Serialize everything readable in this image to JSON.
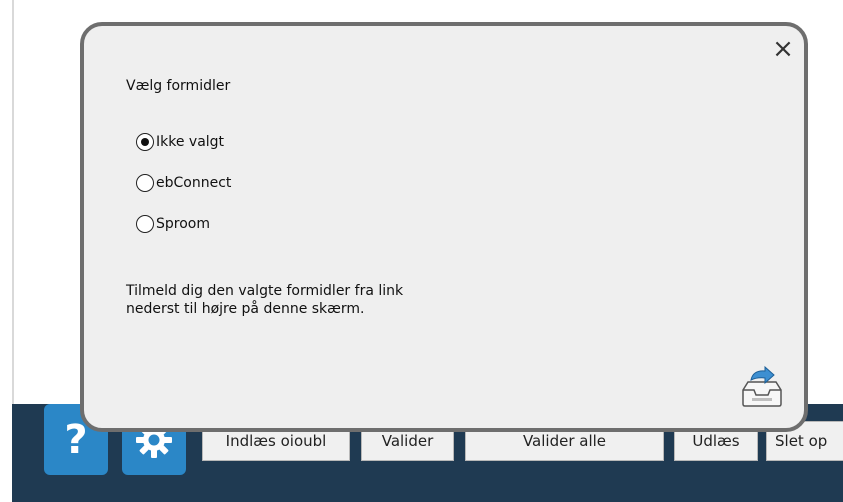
{
  "dialog": {
    "title": "Vælg formidler",
    "close_label": "×",
    "options": [
      {
        "label": "Ikke valgt",
        "checked": true
      },
      {
        "label": "ebConnect",
        "checked": false
      },
      {
        "label": "Sproom",
        "checked": false
      }
    ],
    "info_line1": "Tilmeld dig den valgte formidler fra link",
    "info_line2": "nederst til højre på denne skærm.",
    "import_icon": "import-tray-icon"
  },
  "toolbar": {
    "help_label": "?",
    "settings_icon": "gear-icon",
    "buttons": [
      {
        "label": "Indlæs oioubl"
      },
      {
        "label": "Valider"
      },
      {
        "label": "Valider alle"
      },
      {
        "label": "Udlæs"
      },
      {
        "label": "Slet op"
      }
    ]
  },
  "colors": {
    "bottom_bar": "#1f3a52",
    "icon_button": "#2b87c7",
    "dialog_bg": "#efefef",
    "dialog_border": "#6e6e6e"
  }
}
